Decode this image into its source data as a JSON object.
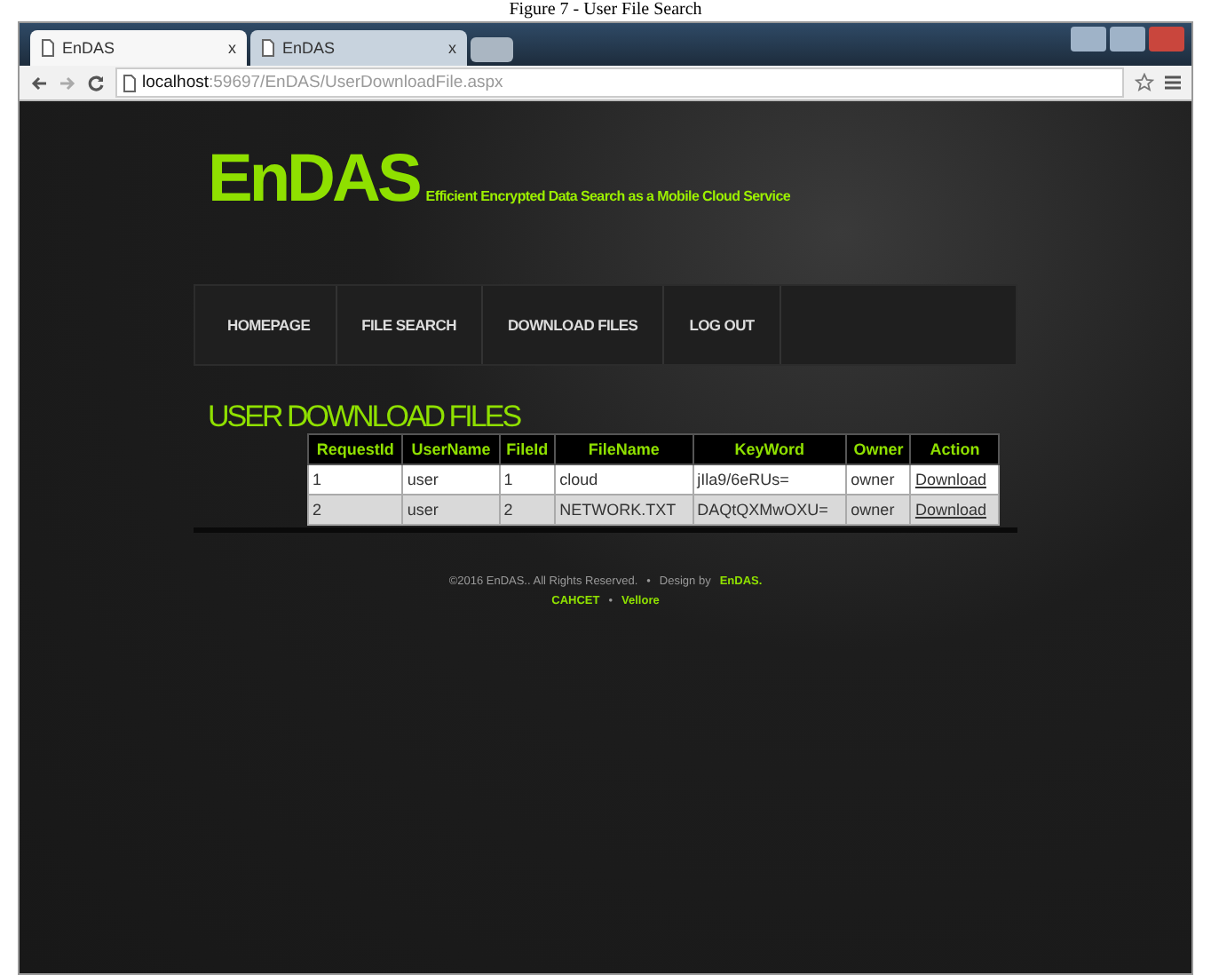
{
  "caption": "Figure 7 - User File Search",
  "tabs": [
    {
      "label": "EnDAS",
      "close": "x",
      "selected": true
    },
    {
      "label": "EnDAS",
      "close": "x",
      "selected": false
    }
  ],
  "address": {
    "host": "localhost",
    "path": ":59697/EnDAS/UserDownloadFile.aspx"
  },
  "logo": {
    "name": "EnDAS",
    "tagline": "Efficient Encrypted Data Search as a Mobile Cloud Service"
  },
  "nav": [
    "HOMEPAGE",
    "FILE SEARCH",
    "DOWNLOAD FILES",
    "LOG OUT"
  ],
  "section_title": "USER DOWNLOAD FILES",
  "table": {
    "columns": [
      "RequestId",
      "UserName",
      "FileId",
      "FileName",
      "KeyWord",
      "Owner",
      "Action"
    ],
    "rows": [
      [
        "1",
        "user",
        "1",
        "cloud",
        "jIla9/6eRUs=",
        "owner",
        "Download"
      ],
      [
        "2",
        "user",
        "2",
        "NETWORK.TXT",
        "DAQtQXMwOXU=",
        "owner",
        "Download"
      ]
    ]
  },
  "footer": {
    "copyright": "©2016 EnDAS.. All Rights Reserved.",
    "sep": "•",
    "design_prefix": "Design by",
    "design_link": "EnDAS.",
    "links": [
      "CAHCET",
      "Vellore"
    ]
  }
}
